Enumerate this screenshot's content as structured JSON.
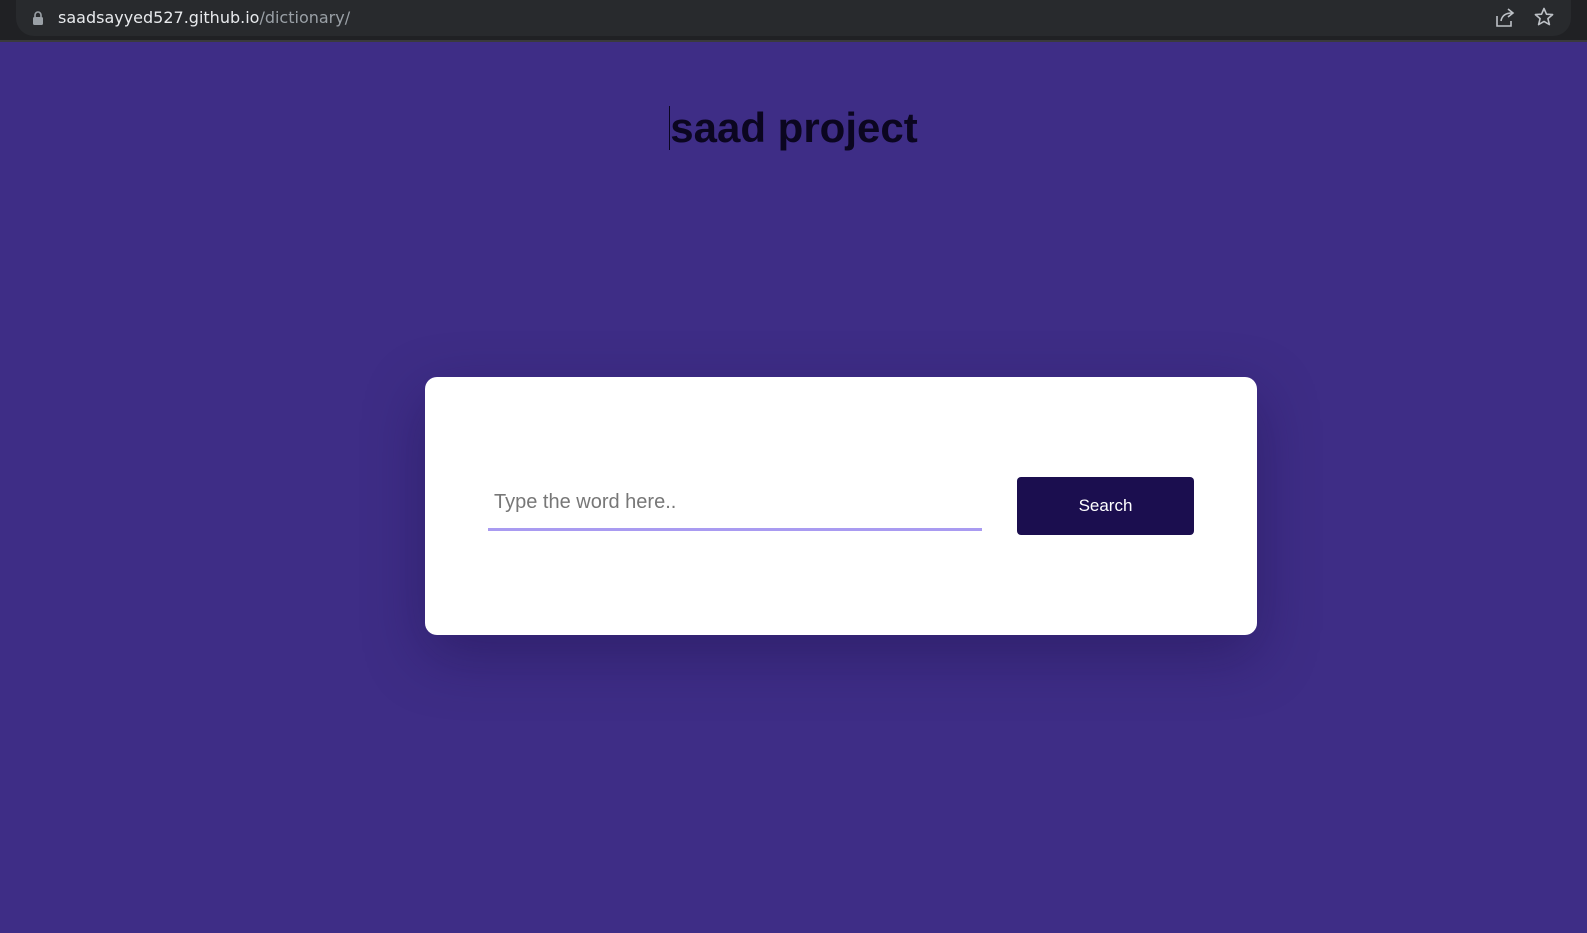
{
  "browser": {
    "url_host": "saadsayyed527.github.io",
    "url_path": "/dictionary/",
    "icons": [
      "lock-icon",
      "share-icon",
      "star-icon"
    ]
  },
  "page": {
    "title": "saad project",
    "background_color": "#3e2d86"
  },
  "search": {
    "placeholder": "Type the word here..",
    "value": "",
    "button_label": "Search",
    "button_color": "#1b0e4f",
    "underline_color": "#a99bf1"
  }
}
